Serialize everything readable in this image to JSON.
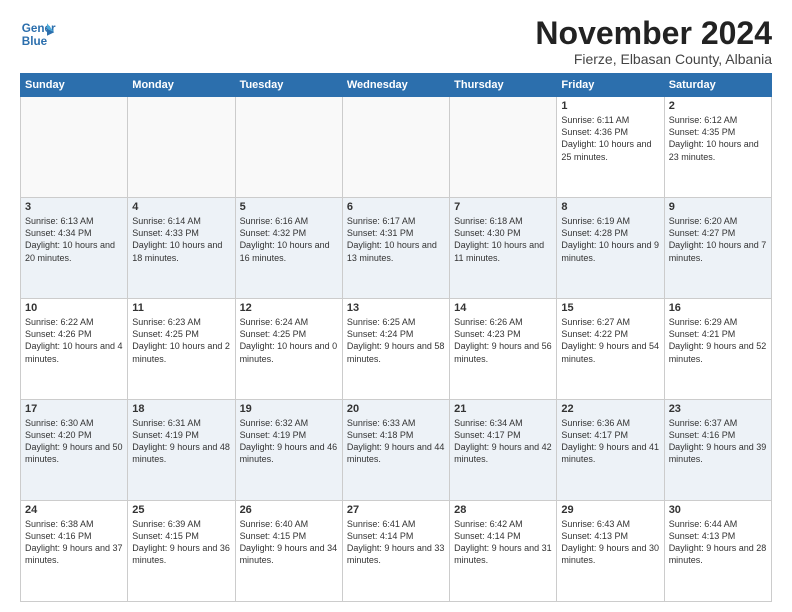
{
  "logo": {
    "line1": "General",
    "line2": "Blue"
  },
  "header": {
    "month": "November 2024",
    "location": "Fierze, Elbasan County, Albania"
  },
  "weekdays": [
    "Sunday",
    "Monday",
    "Tuesday",
    "Wednesday",
    "Thursday",
    "Friday",
    "Saturday"
  ],
  "weeks": [
    [
      {
        "day": "",
        "detail": ""
      },
      {
        "day": "",
        "detail": ""
      },
      {
        "day": "",
        "detail": ""
      },
      {
        "day": "",
        "detail": ""
      },
      {
        "day": "",
        "detail": ""
      },
      {
        "day": "1",
        "detail": "Sunrise: 6:11 AM\nSunset: 4:36 PM\nDaylight: 10 hours and 25 minutes."
      },
      {
        "day": "2",
        "detail": "Sunrise: 6:12 AM\nSunset: 4:35 PM\nDaylight: 10 hours and 23 minutes."
      }
    ],
    [
      {
        "day": "3",
        "detail": "Sunrise: 6:13 AM\nSunset: 4:34 PM\nDaylight: 10 hours and 20 minutes."
      },
      {
        "day": "4",
        "detail": "Sunrise: 6:14 AM\nSunset: 4:33 PM\nDaylight: 10 hours and 18 minutes."
      },
      {
        "day": "5",
        "detail": "Sunrise: 6:16 AM\nSunset: 4:32 PM\nDaylight: 10 hours and 16 minutes."
      },
      {
        "day": "6",
        "detail": "Sunrise: 6:17 AM\nSunset: 4:31 PM\nDaylight: 10 hours and 13 minutes."
      },
      {
        "day": "7",
        "detail": "Sunrise: 6:18 AM\nSunset: 4:30 PM\nDaylight: 10 hours and 11 minutes."
      },
      {
        "day": "8",
        "detail": "Sunrise: 6:19 AM\nSunset: 4:28 PM\nDaylight: 10 hours and 9 minutes."
      },
      {
        "day": "9",
        "detail": "Sunrise: 6:20 AM\nSunset: 4:27 PM\nDaylight: 10 hours and 7 minutes."
      }
    ],
    [
      {
        "day": "10",
        "detail": "Sunrise: 6:22 AM\nSunset: 4:26 PM\nDaylight: 10 hours and 4 minutes."
      },
      {
        "day": "11",
        "detail": "Sunrise: 6:23 AM\nSunset: 4:25 PM\nDaylight: 10 hours and 2 minutes."
      },
      {
        "day": "12",
        "detail": "Sunrise: 6:24 AM\nSunset: 4:25 PM\nDaylight: 10 hours and 0 minutes."
      },
      {
        "day": "13",
        "detail": "Sunrise: 6:25 AM\nSunset: 4:24 PM\nDaylight: 9 hours and 58 minutes."
      },
      {
        "day": "14",
        "detail": "Sunrise: 6:26 AM\nSunset: 4:23 PM\nDaylight: 9 hours and 56 minutes."
      },
      {
        "day": "15",
        "detail": "Sunrise: 6:27 AM\nSunset: 4:22 PM\nDaylight: 9 hours and 54 minutes."
      },
      {
        "day": "16",
        "detail": "Sunrise: 6:29 AM\nSunset: 4:21 PM\nDaylight: 9 hours and 52 minutes."
      }
    ],
    [
      {
        "day": "17",
        "detail": "Sunrise: 6:30 AM\nSunset: 4:20 PM\nDaylight: 9 hours and 50 minutes."
      },
      {
        "day": "18",
        "detail": "Sunrise: 6:31 AM\nSunset: 4:19 PM\nDaylight: 9 hours and 48 minutes."
      },
      {
        "day": "19",
        "detail": "Sunrise: 6:32 AM\nSunset: 4:19 PM\nDaylight: 9 hours and 46 minutes."
      },
      {
        "day": "20",
        "detail": "Sunrise: 6:33 AM\nSunset: 4:18 PM\nDaylight: 9 hours and 44 minutes."
      },
      {
        "day": "21",
        "detail": "Sunrise: 6:34 AM\nSunset: 4:17 PM\nDaylight: 9 hours and 42 minutes."
      },
      {
        "day": "22",
        "detail": "Sunrise: 6:36 AM\nSunset: 4:17 PM\nDaylight: 9 hours and 41 minutes."
      },
      {
        "day": "23",
        "detail": "Sunrise: 6:37 AM\nSunset: 4:16 PM\nDaylight: 9 hours and 39 minutes."
      }
    ],
    [
      {
        "day": "24",
        "detail": "Sunrise: 6:38 AM\nSunset: 4:16 PM\nDaylight: 9 hours and 37 minutes."
      },
      {
        "day": "25",
        "detail": "Sunrise: 6:39 AM\nSunset: 4:15 PM\nDaylight: 9 hours and 36 minutes."
      },
      {
        "day": "26",
        "detail": "Sunrise: 6:40 AM\nSunset: 4:15 PM\nDaylight: 9 hours and 34 minutes."
      },
      {
        "day": "27",
        "detail": "Sunrise: 6:41 AM\nSunset: 4:14 PM\nDaylight: 9 hours and 33 minutes."
      },
      {
        "day": "28",
        "detail": "Sunrise: 6:42 AM\nSunset: 4:14 PM\nDaylight: 9 hours and 31 minutes."
      },
      {
        "day": "29",
        "detail": "Sunrise: 6:43 AM\nSunset: 4:13 PM\nDaylight: 9 hours and 30 minutes."
      },
      {
        "day": "30",
        "detail": "Sunrise: 6:44 AM\nSunset: 4:13 PM\nDaylight: 9 hours and 28 minutes."
      }
    ]
  ]
}
